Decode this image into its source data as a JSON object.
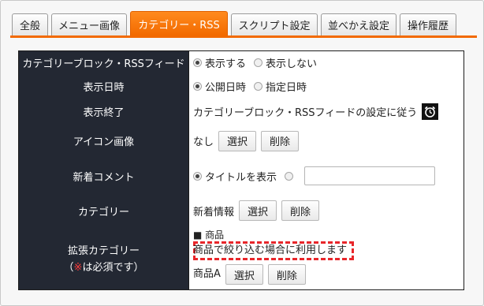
{
  "tabs": [
    {
      "label": "全般",
      "active": false
    },
    {
      "label": "メニュー画像",
      "active": false
    },
    {
      "label": "カテゴリー・RSS",
      "active": true
    },
    {
      "label": "スクリプト設定",
      "active": false
    },
    {
      "label": "並べかえ設定",
      "active": false
    },
    {
      "label": "操作履歴",
      "active": false
    }
  ],
  "colors": {
    "accent": "#f26a00",
    "header_bg": "#232833",
    "highlight": "#e8262a"
  },
  "rows": {
    "category_block": {
      "label": "カテゴリーブロック・RSSフィード",
      "option_show": "表示する",
      "option_hide": "表示しない",
      "selected": "show"
    },
    "display_date": {
      "label": "表示日時",
      "option_publish": "公開日時",
      "option_specified": "指定日時",
      "selected": "publish"
    },
    "display_end": {
      "label": "表示終了",
      "value": "カテゴリーブロック・RSSフィードの設定に従う",
      "icon": "alarm-clock-icon"
    },
    "icon_image": {
      "label": "アイコン画像",
      "value": "なし",
      "select_label": "選択",
      "delete_label": "削除"
    },
    "new_comment": {
      "label": "新着コメント",
      "option_title": "タイトルを表示",
      "input_value": "",
      "selected": "title"
    },
    "category": {
      "label": "カテゴリー",
      "value": "新着情報",
      "select_label": "選択",
      "delete_label": "削除"
    },
    "extended_category": {
      "label": "拡張カテゴリー",
      "required_open": "（",
      "required_mark": "※",
      "required_text": "は必須です）",
      "group_name": "■ 商品",
      "note": "商品で絞り込む場合に利用します",
      "value": "商品A",
      "select_label": "選択",
      "delete_label": "削除"
    }
  }
}
